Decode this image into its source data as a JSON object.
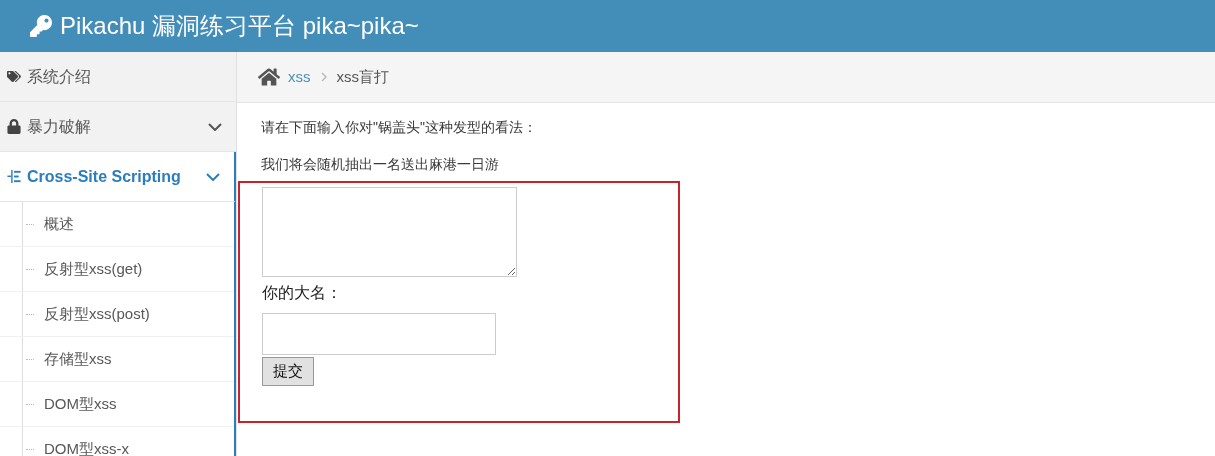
{
  "header": {
    "title": "Pikachu 漏洞练习平台 pika~pika~"
  },
  "sidebar": {
    "items": [
      {
        "label": "系统介绍",
        "kind": "link",
        "selected": false,
        "expanded": false
      },
      {
        "label": "暴力破解",
        "kind": "menu",
        "selected": false,
        "expanded": false
      },
      {
        "label": "Cross-Site Scripting",
        "kind": "menu",
        "selected": true,
        "expanded": true,
        "children": [
          {
            "label": "概述"
          },
          {
            "label": "反射型xss(get)"
          },
          {
            "label": "反射型xss(post)"
          },
          {
            "label": "存储型xss"
          },
          {
            "label": "DOM型xss"
          },
          {
            "label": "DOM型xss-x"
          }
        ]
      }
    ]
  },
  "breadcrumb": [
    {
      "label": "xss",
      "kind": "link"
    },
    {
      "label": "xss盲打",
      "kind": "current"
    }
  ],
  "content": {
    "paragraphs": [
      "请在下面输入你对\"锅盖头\"这种发型的看法：",
      "我们将会随机抽出一名送出麻港一日游"
    ],
    "form": {
      "name_label": "你的大名：",
      "submit": "提交"
    }
  }
}
